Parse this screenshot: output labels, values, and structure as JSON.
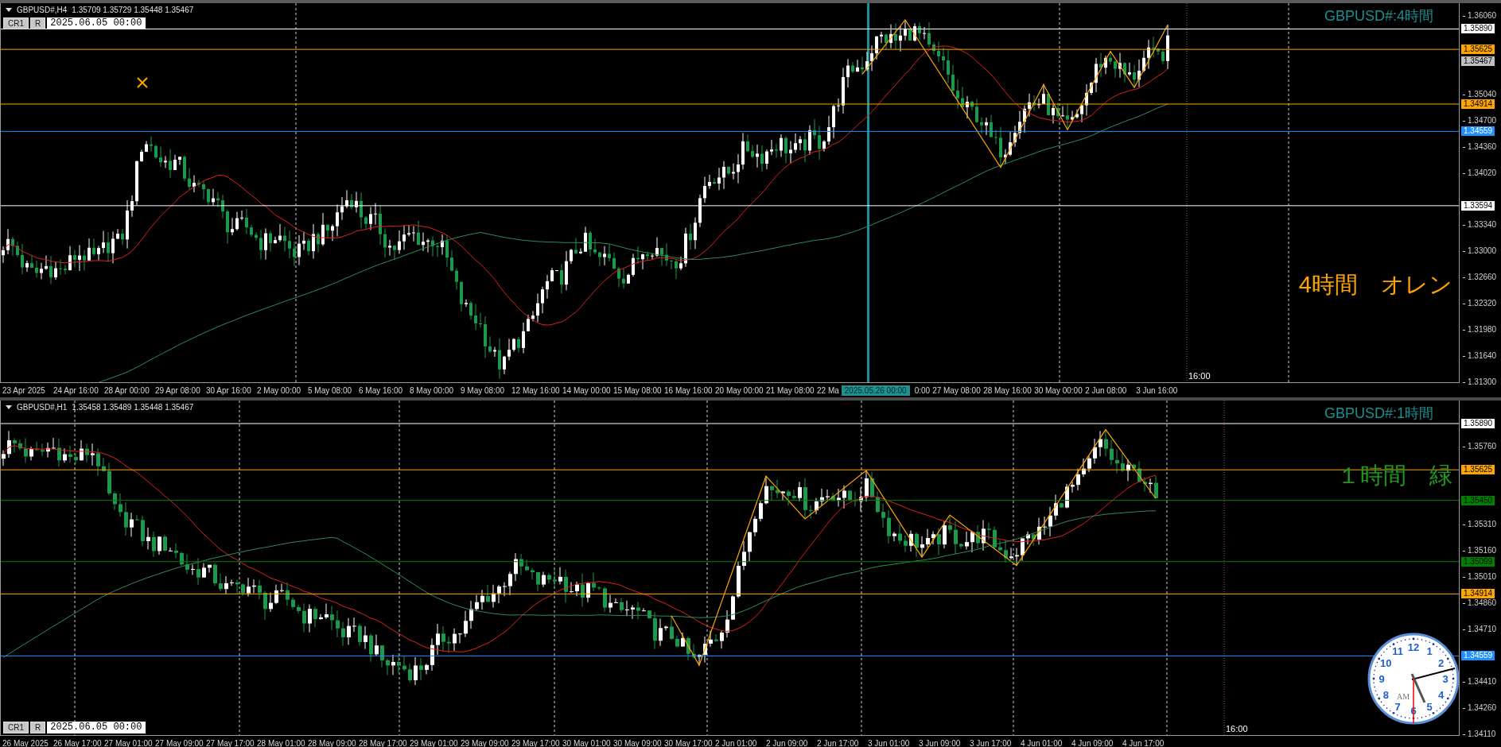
{
  "panels": [
    {
      "kind": "upper",
      "header": {
        "symbol": "GBPUSD#,H4",
        "quotes": "1.35709 1.35729 1.35448 1.35467"
      },
      "date_box": {
        "buttons": [
          "CR1",
          "R"
        ],
        "value": "2025.06.05 00:00"
      },
      "title": "GBPUSD#:4時間",
      "note": {
        "text": "4時間　オレン",
        "color": "#ffa500"
      },
      "price_ticks": [
        "1.36060",
        "1.35040",
        "1.34700",
        "1.34360",
        "1.34020",
        "1.33340",
        "1.33000",
        "1.32660",
        "1.32320",
        "1.31980",
        "1.31640",
        "1.31300"
      ],
      "price_lines": [
        {
          "label": "1.35890",
          "color": "#ffffff",
          "kind": "level"
        },
        {
          "label": "1.35625",
          "color": "#ffa500",
          "kind": "level"
        },
        {
          "label": "1.35467",
          "color": "#c0c0c0",
          "kind": "bid"
        },
        {
          "label": "1.34914",
          "color": "#ffa500",
          "kind": "level"
        },
        {
          "label": "1.34559",
          "color": "#1e90ff",
          "kind": "level"
        },
        {
          "label": "1.33594",
          "color": "#ffffff",
          "kind": "level"
        }
      ],
      "time_labels": [
        {
          "text": "23 Apr 2025",
          "kind": "label"
        },
        {
          "text": "24 Apr 16:00",
          "kind": "label"
        },
        {
          "text": "28 Apr 00:00",
          "kind": "label"
        },
        {
          "text": "29 Apr 08:00",
          "kind": "label"
        },
        {
          "text": "30 Apr 16:00",
          "kind": "label"
        },
        {
          "text": "2 May 00:00",
          "kind": "label"
        },
        {
          "text": "5 May 08:00",
          "kind": "label"
        },
        {
          "text": "6 May 16:00",
          "kind": "label"
        },
        {
          "text": "8 May 00:00",
          "kind": "label"
        },
        {
          "text": "9 May 08:00",
          "kind": "label"
        },
        {
          "text": "12 May 16:00",
          "kind": "label"
        },
        {
          "text": "14 May 00:00",
          "kind": "label"
        },
        {
          "text": "15 May 08:00",
          "kind": "label"
        },
        {
          "text": "16 May 16:00",
          "kind": "label"
        },
        {
          "text": "20 May 00:00",
          "kind": "label"
        },
        {
          "text": "21 May 08:00",
          "kind": "label"
        },
        {
          "text": "22 Ma",
          "kind": "cut"
        },
        {
          "text": "2025.05.26 00:00",
          "kind": "highlight"
        },
        {
          "text": "0:00",
          "kind": "cut"
        },
        {
          "text": "27 May 08:00",
          "kind": "label"
        },
        {
          "text": "28 May 16:00",
          "kind": "label"
        },
        {
          "text": "30 May 00:00",
          "kind": "label"
        },
        {
          "text": "2 Jun 08:00",
          "kind": "label"
        },
        {
          "text": "3 Jun 16:00",
          "kind": "label"
        }
      ],
      "cursor_time": "16:00"
    },
    {
      "kind": "lower",
      "header": {
        "symbol": "GBPUSD#,H1",
        "quotes": "1.35458 1.35489 1.35448 1.35467"
      },
      "date_box": {
        "buttons": [
          "CR1",
          "R"
        ],
        "value": "2025.06.05 00:00"
      },
      "title": "GBPUSD#:1時間",
      "note": {
        "text": "１時間　緑",
        "color": "#1f9a1f"
      },
      "price_ticks": [
        "1.35760",
        "1.35310",
        "1.35160",
        "1.35010",
        "1.34860",
        "1.34710",
        "1.34410",
        "1.34260",
        "1.34110"
      ],
      "price_lines": [
        {
          "label": "1.35890",
          "color": "#ffffff",
          "kind": "level"
        },
        {
          "label": "1.35625",
          "color": "#ffa500",
          "kind": "level"
        },
        {
          "label": "1.35450",
          "color": "#008000",
          "kind": "level"
        },
        {
          "label": "1.35099",
          "color": "#008000",
          "kind": "level"
        },
        {
          "label": "1.34914",
          "color": "#ffa500",
          "kind": "level"
        },
        {
          "label": "1.34559",
          "color": "#1e90ff",
          "kind": "level"
        }
      ],
      "time_labels": [
        {
          "text": "26 May 2025",
          "kind": "label"
        },
        {
          "text": "26 May 17:00",
          "kind": "label"
        },
        {
          "text": "27 May 01:00",
          "kind": "label"
        },
        {
          "text": "27 May 09:00",
          "kind": "label"
        },
        {
          "text": "27 May 17:00",
          "kind": "label"
        },
        {
          "text": "28 May 01:00",
          "kind": "label"
        },
        {
          "text": "28 May 09:00",
          "kind": "label"
        },
        {
          "text": "28 May 17:00",
          "kind": "label"
        },
        {
          "text": "29 May 01:00",
          "kind": "label"
        },
        {
          "text": "29 May 09:00",
          "kind": "label"
        },
        {
          "text": "29 May 17:00",
          "kind": "label"
        },
        {
          "text": "30 May 01:00",
          "kind": "label"
        },
        {
          "text": "30 May 09:00",
          "kind": "label"
        },
        {
          "text": "30 May 17:00",
          "kind": "label"
        },
        {
          "text": "2 Jun 01:00",
          "kind": "label"
        },
        {
          "text": "2 Jun 09:00",
          "kind": "label"
        },
        {
          "text": "2 Jun 17:00",
          "kind": "label"
        },
        {
          "text": "3 Jun 01:00",
          "kind": "label"
        },
        {
          "text": "3 Jun 09:00",
          "kind": "label"
        },
        {
          "text": "3 Jun 17:00",
          "kind": "label"
        },
        {
          "text": "4 Jun 01:00",
          "kind": "label"
        },
        {
          "text": "4 Jun 09:00",
          "kind": "label"
        },
        {
          "text": "4 Jun 17:00",
          "kind": "label"
        }
      ],
      "cursor_time": "16:00"
    }
  ],
  "clock": {
    "numerals": [
      "12",
      "11",
      "1",
      "10",
      "2",
      "9",
      "3",
      "8",
      "4",
      "7",
      "5",
      "6"
    ],
    "period": "AM"
  }
}
